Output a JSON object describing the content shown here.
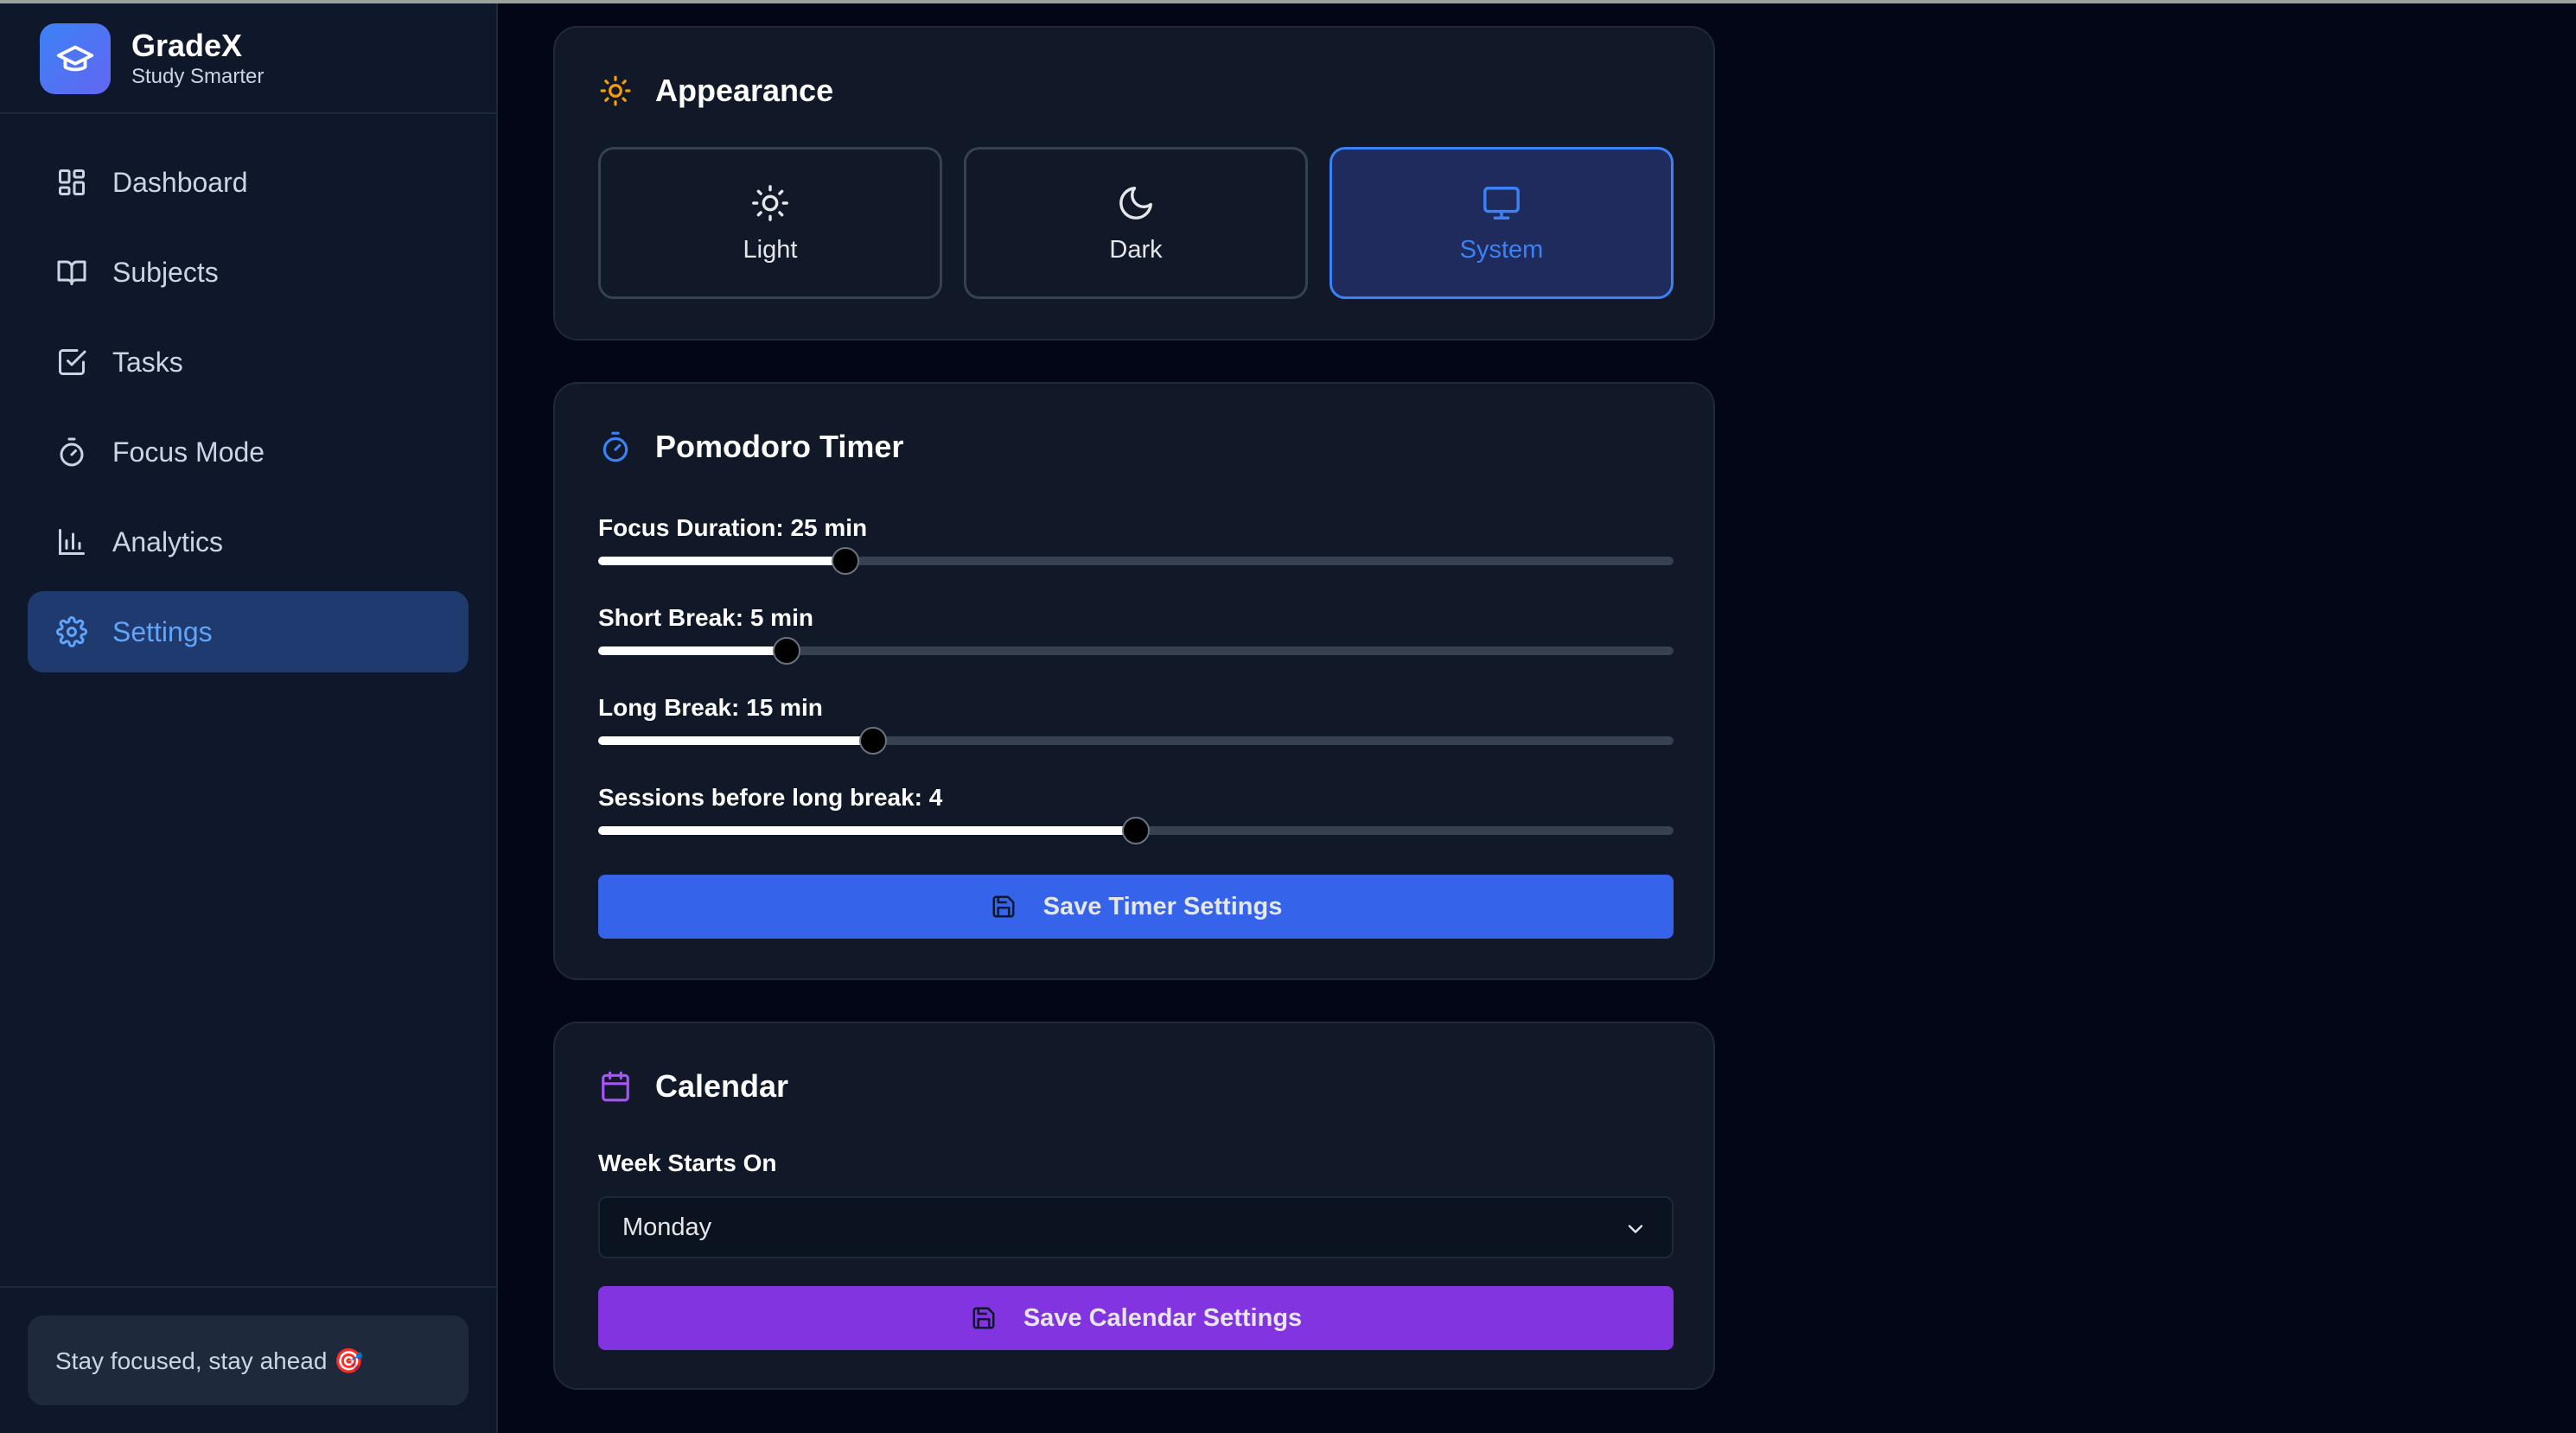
{
  "app": {
    "name": "GradeX",
    "tagline": "Study Smarter"
  },
  "sidebar": {
    "items": [
      {
        "label": "Dashboard",
        "icon": "dashboard-icon"
      },
      {
        "label": "Subjects",
        "icon": "book-icon"
      },
      {
        "label": "Tasks",
        "icon": "checkbox-icon"
      },
      {
        "label": "Focus Mode",
        "icon": "timer-icon"
      },
      {
        "label": "Analytics",
        "icon": "bar-chart-icon"
      },
      {
        "label": "Settings",
        "icon": "gear-icon",
        "active": true
      }
    ],
    "footer": "Stay focused, stay ahead 🎯"
  },
  "appearance": {
    "title": "Appearance",
    "options": [
      {
        "label": "Light",
        "icon": "sun-icon"
      },
      {
        "label": "Dark",
        "icon": "moon-icon"
      },
      {
        "label": "System",
        "icon": "monitor-icon",
        "selected": true
      }
    ]
  },
  "pomodoro": {
    "title": "Pomodoro Timer",
    "sliders": [
      {
        "label": "Focus Duration: 25 min",
        "fraction": 0.23
      },
      {
        "label": "Short Break: 5 min",
        "fraction": 0.175
      },
      {
        "label": "Long Break: 15 min",
        "fraction": 0.256
      },
      {
        "label": "Sessions before long break: 4",
        "fraction": 0.5
      }
    ],
    "save_label": "Save Timer Settings"
  },
  "calendar": {
    "title": "Calendar",
    "week_label": "Week Starts On",
    "week_value": "Monday",
    "save_label": "Save Calendar Settings"
  },
  "colors": {
    "accent_blue": "#3b82f6",
    "timer_button": "#3563e9",
    "calendar_button": "#8234e0",
    "sun_orange": "#f59e0b",
    "calendar_purple": "#a855f7"
  }
}
